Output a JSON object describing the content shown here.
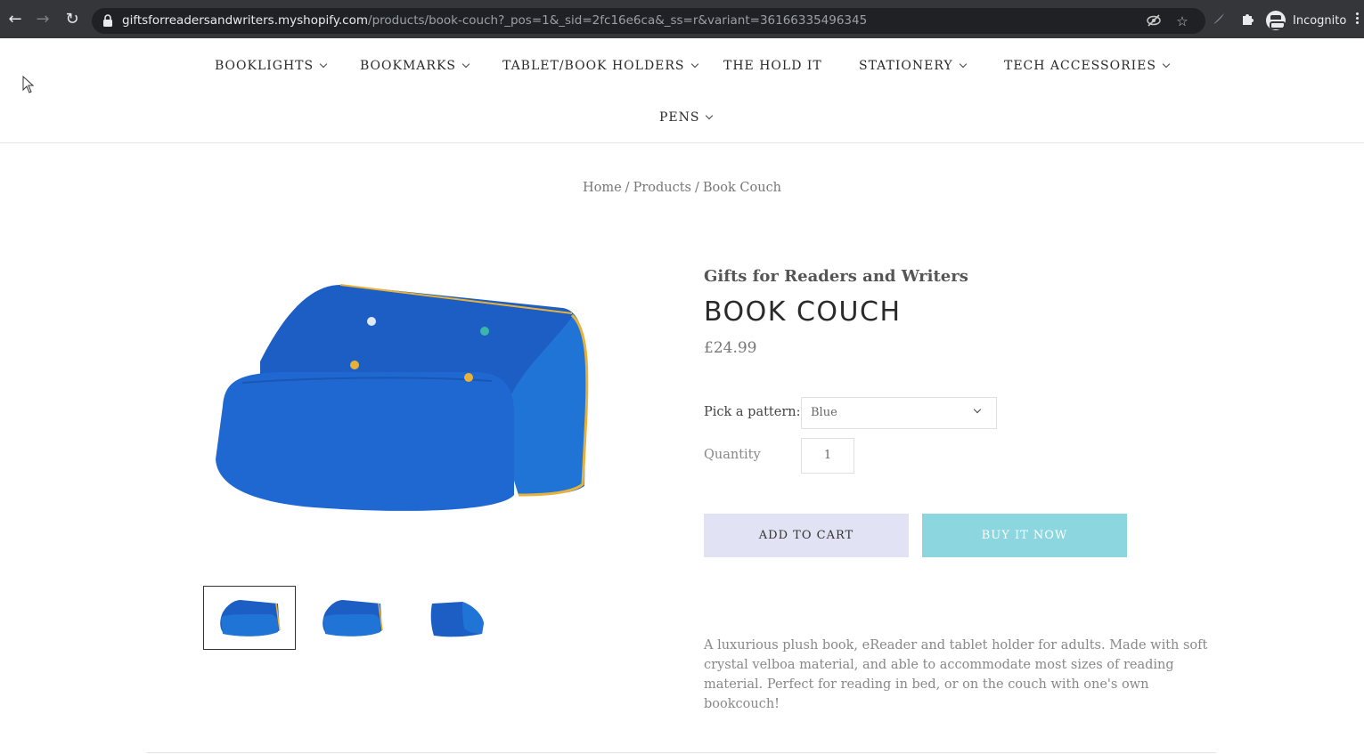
{
  "browser": {
    "url_host": "giftsforreadersandwriters.myshopify.com",
    "url_path": "/products/book-couch?_pos=1&_sid=2fc16e6ca&_ss=r&variant=36166335496345",
    "profile_label": "Incognito",
    "icons": [
      "back-icon",
      "forward-icon",
      "reload-icon",
      "lock-icon",
      "eye-off-icon",
      "star-icon",
      "feather-icon",
      "puzzle-icon",
      "incognito-icon",
      "more-icon"
    ]
  },
  "nav": {
    "items": [
      {
        "label": "BOOKLIGHTS",
        "has_dropdown": true
      },
      {
        "label": "BOOKMARKS",
        "has_dropdown": true
      },
      {
        "label": "TABLET/BOOK HOLDERS",
        "has_dropdown": true
      },
      {
        "label": "THE HOLD IT",
        "has_dropdown": false
      },
      {
        "label": "STATIONERY",
        "has_dropdown": true
      },
      {
        "label": "TECH ACCESSORIES",
        "has_dropdown": true
      },
      {
        "label": "PENS",
        "has_dropdown": true
      }
    ]
  },
  "breadcrumb": {
    "home": "Home",
    "sep": "/",
    "products": "Products",
    "current": "Book Couch"
  },
  "product": {
    "vendor": "Gifts for Readers and Writers",
    "title": "BOOK COUCH",
    "price": "£24.99",
    "pattern_label": "Pick a pattern:",
    "pattern_value": "Blue",
    "quantity_label": "Quantity",
    "quantity_value": "1",
    "add_to_cart": "ADD TO CART",
    "buy_now": "BUY IT NOW",
    "description": "A luxurious plush book, eReader and tablet holder for adults. Made with soft crystal velboa material, and able to accommodate most sizes of reading material. Perfect for reading in bed, or on the couch with one's own bookcouch!",
    "thumbnails": [
      "thumbnail-1",
      "thumbnail-2",
      "thumbnail-3"
    ]
  },
  "colors": {
    "chrome": "#35363a",
    "omnibox": "#202124",
    "product_blue": "#1a5fc4",
    "piping_gold": "#e8b23a",
    "cart_button": "#e1e2f4",
    "buy_button": "#8cd6df"
  }
}
